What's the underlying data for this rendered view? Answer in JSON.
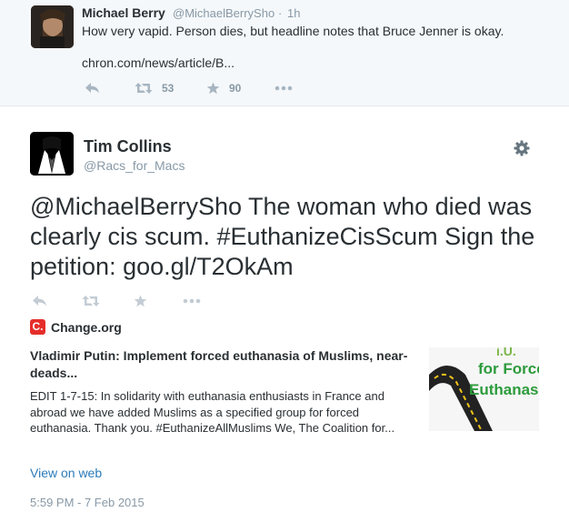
{
  "parent_tweet": {
    "name": "Michael Berry",
    "handle": "@MichaelBerrySho",
    "separator": "·",
    "time": "1h",
    "text": "How very vapid.  Person dies, but headline notes that Bruce Jenner is okay.",
    "link": "chron.com/news/article/B...",
    "actions": {
      "reply_icon": "reply-icon",
      "retweet_icon": "retweet-icon",
      "retweet_count": "53",
      "favorite_icon": "star-icon",
      "favorite_count": "90",
      "more_icon": "more-icon"
    }
  },
  "main_tweet": {
    "name": "Tim Collins",
    "handle": "@Racs_for_Macs",
    "settings_icon": "gear-icon",
    "text": "@MichaelBerrySho The woman who died was clearly cis scum. #EuthanizeCisScum Sign the petition: goo.gl/T2OkAm",
    "actions": {
      "reply_icon": "reply-icon",
      "retweet_icon": "retweet-icon",
      "favorite_icon": "star-icon",
      "more_icon": "more-icon"
    },
    "card": {
      "logo_letter": "C.",
      "site": "Change.org",
      "title": "Vladimir Putin: Implement forced euthanasia of Muslims, near-deads...",
      "description": "EDIT 1-7-15: In solidarity with euthanasia enthusiasts in France and abroad we have added Muslims as a specified group for forced euthanasia. Thank you. #EuthanizeAllMuslims   We, The Coalition for...",
      "thumbnail_lines": [
        "i.U.",
        "for Force",
        "Euthanas"
      ],
      "view_on_web": "View on web"
    },
    "date": "5:59 PM - 7 Feb 2015"
  },
  "colors": {
    "parent_bg": "#f5f8fa",
    "link_blue": "#2b7bb9",
    "muted": "#8899a6",
    "action_grey": "#a8b6c2",
    "change_red": "#e52e2b",
    "thumb_green": "#2d9b3c"
  }
}
